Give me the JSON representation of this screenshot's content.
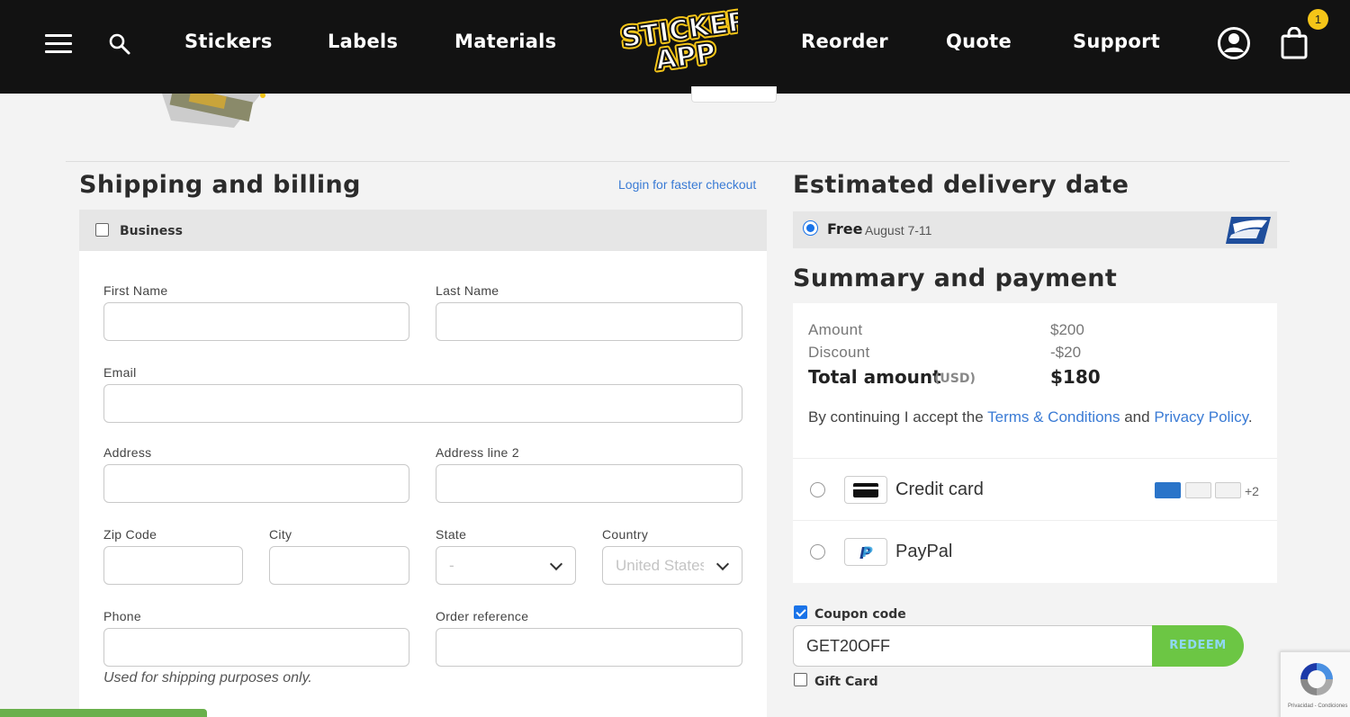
{
  "header": {
    "nav_left": [
      "Stickers",
      "Labels",
      "Materials"
    ],
    "nav_right": [
      "Reorder",
      "Quote",
      "Support"
    ],
    "logo_text": "STICKER APP",
    "cart_count": "1"
  },
  "shipping": {
    "title": "Shipping and billing",
    "login_link": "Login for faster checkout",
    "business_label": "Business",
    "fields": {
      "first_name": "First Name",
      "last_name": "Last Name",
      "email": "Email",
      "address": "Address",
      "address2": "Address line 2",
      "zip": "Zip Code",
      "city": "City",
      "state": "State",
      "country": "Country",
      "phone": "Phone",
      "order_ref": "Order reference"
    },
    "state_value": "-",
    "country_value": "United States",
    "phone_hint": "Used for shipping purposes only."
  },
  "delivery": {
    "title": "Estimated delivery date",
    "option_label": "Free",
    "option_date": "August 7-11"
  },
  "summary": {
    "title": "Summary and payment",
    "amount_label": "Amount",
    "amount_value": "$200",
    "discount_label": "Discount",
    "discount_value": "-$20",
    "total_label": "Total amount",
    "total_unit": "(USD)",
    "total_value": "$180",
    "terms_prefix": "By continuing I accept the ",
    "terms_link": "Terms & Conditions",
    "terms_mid": " and ",
    "privacy_link": "Privacy Policy",
    "terms_suffix": "."
  },
  "payment": {
    "credit_card_label": "Credit card",
    "more_cards": "+2",
    "paypal_label": "PayPal"
  },
  "coupon": {
    "checkbox_label": "Coupon code",
    "code": "GET20OFF",
    "redeem_label": "REDEEM",
    "gift_label": "Gift Card"
  },
  "recaptcha": {
    "footer": "Privacidad - Condiciones"
  },
  "colors": {
    "header_bg": "#121212",
    "link": "#3a7bd5",
    "redeem_bg": "#6cc644",
    "radio_active": "#1a73e8"
  }
}
